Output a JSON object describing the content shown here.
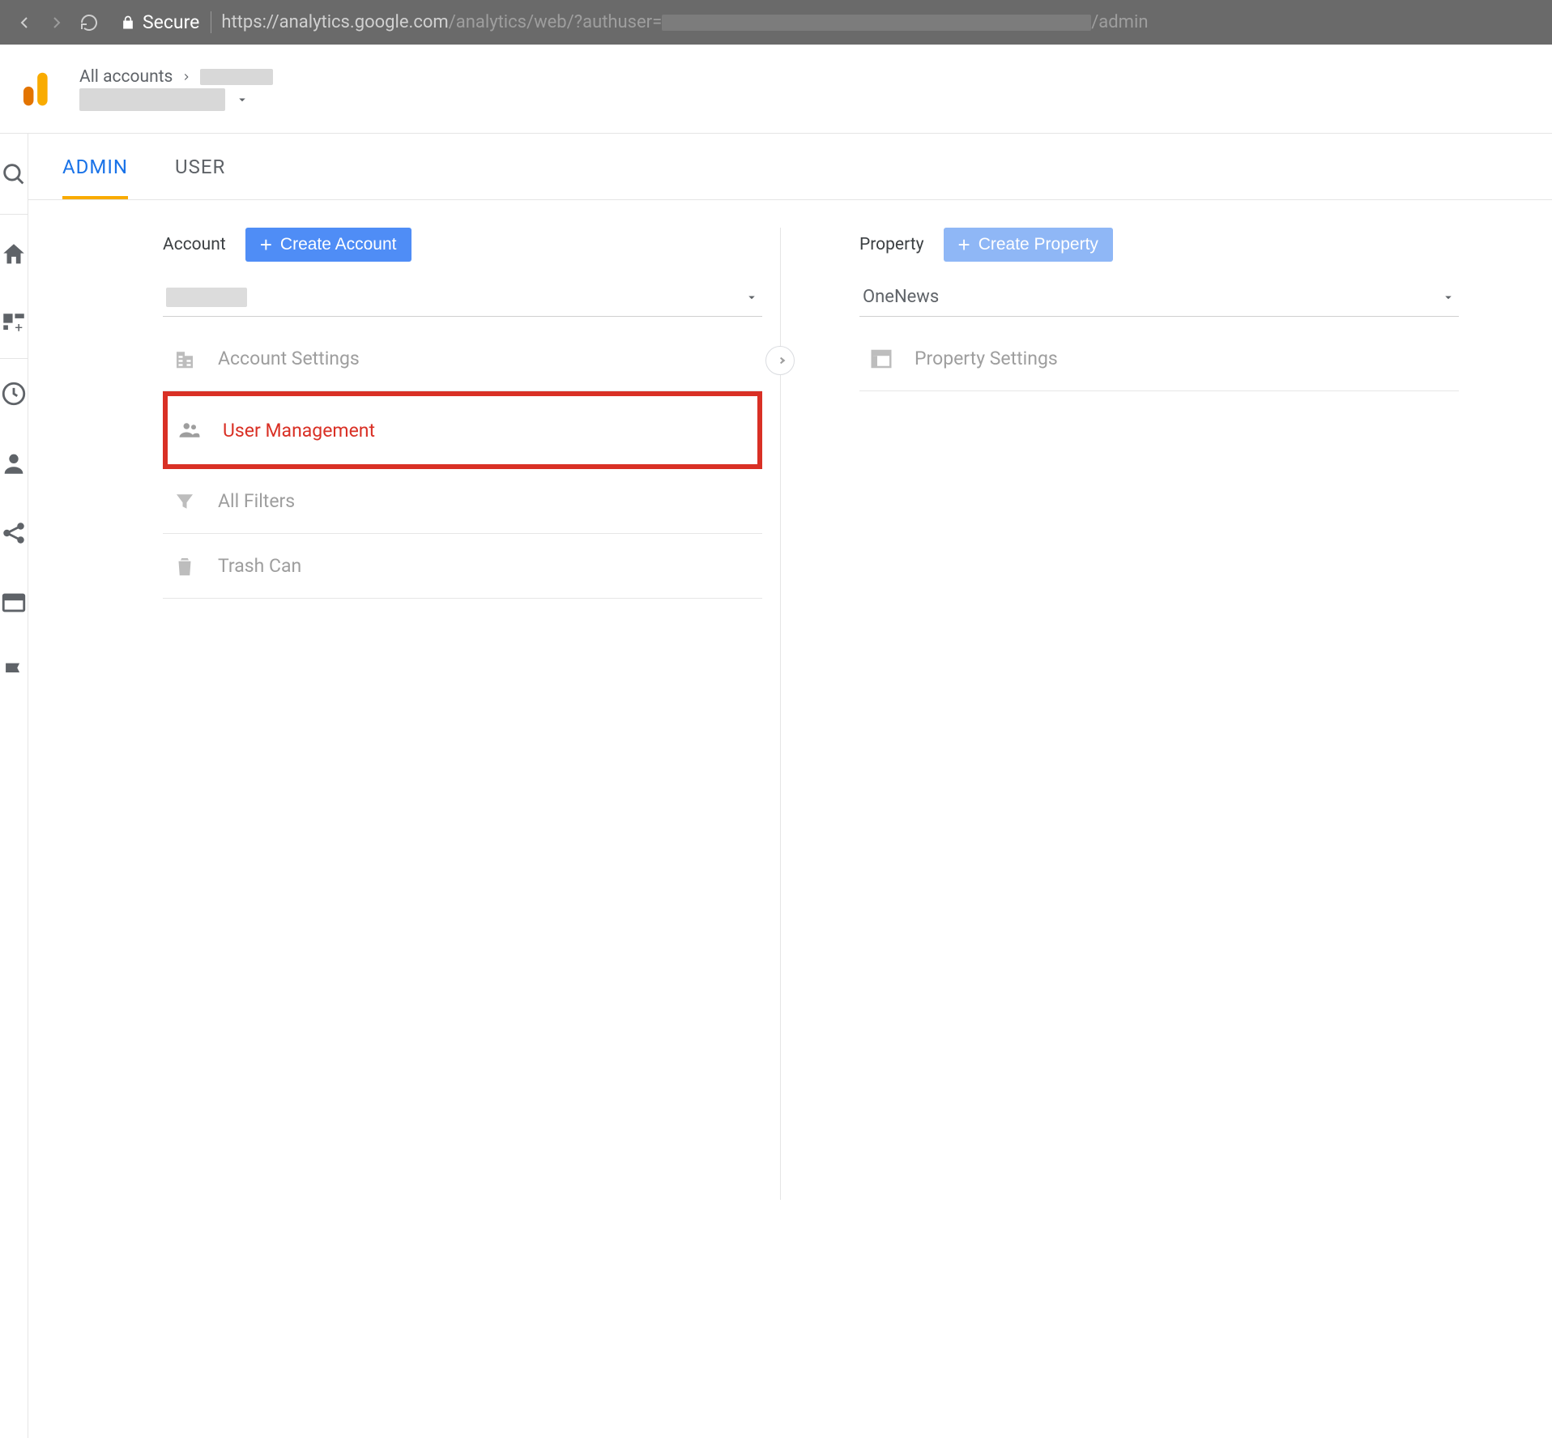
{
  "browser": {
    "secure_label": "Secure",
    "url_host": "https://analytics.google.com",
    "url_path_pre": "/analytics/web/?authuser=",
    "url_path_post": "/admin"
  },
  "header": {
    "breadcrumb_root": "All accounts"
  },
  "tabs": {
    "admin": "ADMIN",
    "user": "USER"
  },
  "account_col": {
    "label": "Account",
    "create_label": "Create Account",
    "rows": {
      "settings": "Account Settings",
      "user_mgmt": "User Management",
      "filters": "All Filters",
      "trash": "Trash Can"
    }
  },
  "property_col": {
    "label": "Property",
    "create_label": "Create Property",
    "selected": "OneNews",
    "rows": {
      "settings": "Property Settings"
    }
  }
}
